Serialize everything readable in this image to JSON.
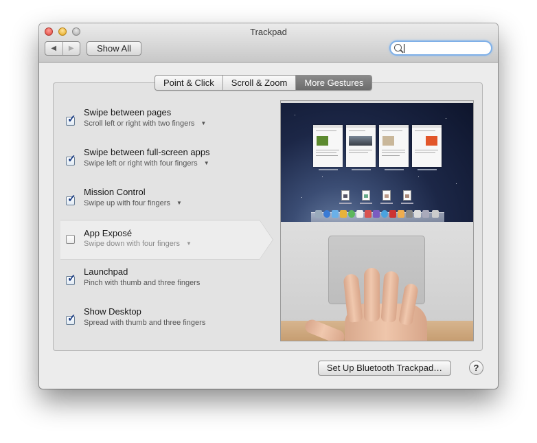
{
  "window": {
    "title": "Trackpad",
    "nav_back": "◀",
    "nav_forward": "▶",
    "show_all": "Show All",
    "search_value": ""
  },
  "tabs": [
    {
      "label": "Point & Click",
      "active": false
    },
    {
      "label": "Scroll & Zoom",
      "active": false
    },
    {
      "label": "More Gestures",
      "active": true
    }
  ],
  "gestures": [
    {
      "title": "Swipe between pages",
      "subtitle": "Scroll left or right with two fingers",
      "checked": true,
      "has_menu": true
    },
    {
      "title": "Swipe between full-screen apps",
      "subtitle": "Swipe left or right with four fingers",
      "checked": true,
      "has_menu": true
    },
    {
      "title": "Mission Control",
      "subtitle": "Swipe up with four fingers",
      "checked": true,
      "has_menu": true
    },
    {
      "title": "App Exposé",
      "subtitle": "Swipe down with four fingers",
      "checked": false,
      "has_menu": true,
      "selected": true
    },
    {
      "title": "Launchpad",
      "subtitle": "Pinch with thumb and three fingers",
      "checked": true,
      "has_menu": false
    },
    {
      "title": "Show Desktop",
      "subtitle": "Spread with thumb and three fingers",
      "checked": true,
      "has_menu": false
    }
  ],
  "footer": {
    "bluetooth_button": "Set Up Bluetooth Trackpad…",
    "help": "?"
  },
  "colors": {
    "accent_tab": "#7a7a7a",
    "checkmark": "#1d3f86",
    "search_focus": "#7fb0e8"
  }
}
